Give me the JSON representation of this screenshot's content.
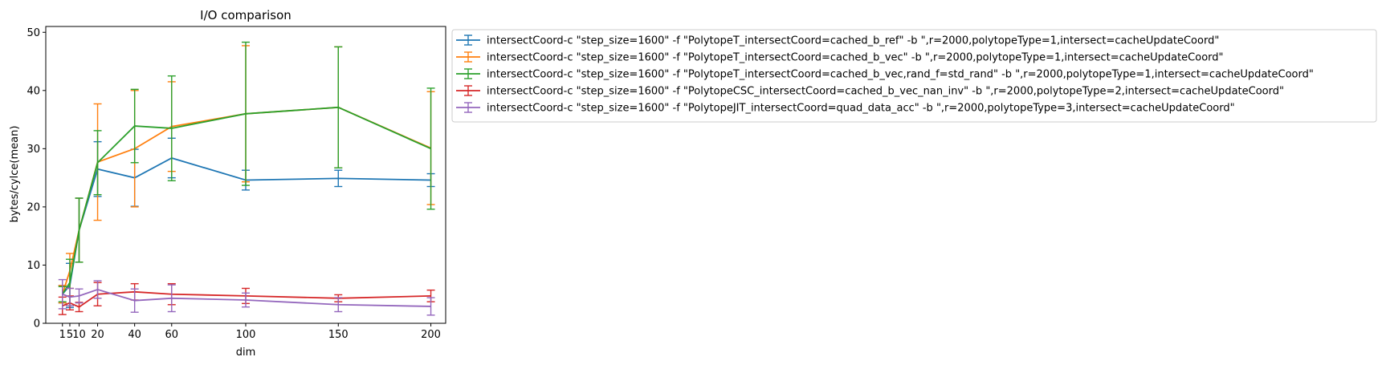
{
  "chart_data": {
    "type": "line",
    "title": "I/O comparison",
    "xlabel": "dim",
    "ylabel": "bytes/cylce(mean)",
    "xlim": [
      -8,
      208
    ],
    "ylim": [
      0,
      51
    ],
    "xticks": [
      1,
      5,
      10,
      20,
      40,
      60,
      100,
      150,
      200
    ],
    "yticks": [
      0,
      10,
      20,
      30,
      40,
      50
    ],
    "grid": false,
    "legend_position": "outside-top-right",
    "x": [
      1,
      5,
      10,
      20,
      40,
      60,
      100,
      150,
      200
    ],
    "series": [
      {
        "name": "intersectCoord-c \"step_size=1600\" -f \"PolytopeT_intersectCoord=cached_b_ref\" -b \",r=2000,polytopeType=1,intersect=cacheUpdateCoord\"",
        "color": "#1f77b4",
        "values": [
          5.0,
          6.5,
          16.0,
          26.5,
          25.0,
          28.4,
          24.6,
          24.9,
          24.6
        ],
        "err": [
          1.5,
          3.8,
          5.5,
          4.7,
          4.9,
          3.4,
          1.7,
          1.4,
          1.1
        ]
      },
      {
        "name": "intersectCoord-c \"step_size=1600\" -f \"PolytopeT_intersectCoord=cached_b_vec\" -b \",r=2000,polytopeType=1,intersect=cacheUpdateCoord\"",
        "color": "#ff7f0e",
        "values": [
          5.0,
          9.0,
          16.0,
          27.7,
          30.0,
          33.8,
          36.0,
          37.1,
          30.1
        ],
        "err": [
          1.5,
          3.0,
          5.5,
          10.0,
          10.0,
          7.7,
          11.7,
          10.4,
          9.7
        ]
      },
      {
        "name": "intersectCoord-c \"step_size=1600\" -f \"PolytopeT_intersectCoord=cached_b_vec,rand_f=std_rand\" -b \",r=2000,polytopeType=1,intersect=cacheUpdateCoord\"",
        "color": "#2ca02c",
        "values": [
          5.0,
          7.0,
          16.0,
          27.6,
          33.9,
          33.5,
          36.0,
          37.1,
          30.0
        ],
        "err": [
          1.3,
          4.0,
          5.5,
          5.5,
          6.3,
          9.0,
          12.3,
          10.4,
          10.4
        ]
      },
      {
        "name": "intersectCoord-c \"step_size=1600\" -f \"PolytopeCSC_intersectCoord=cached_b_vec_nan_inv\" -b \",r=2000,polytopeType=2,intersect=cacheUpdateCoord\"",
        "color": "#d62728",
        "values": [
          3.0,
          3.5,
          2.8,
          5.0,
          5.4,
          5.0,
          4.7,
          4.3,
          4.7
        ],
        "err": [
          1.5,
          1.2,
          0.8,
          2.0,
          1.4,
          1.8,
          1.3,
          0.6,
          1.0
        ]
      },
      {
        "name": "intersectCoord-c \"step_size=1600\" -f \"PolytopeJIT_intersectCoord=quad_data_acc\" -b \",r=2000,polytopeType=3,intersect=cacheUpdateCoord\"",
        "color": "#9467bd",
        "values": [
          5.0,
          4.5,
          4.7,
          5.8,
          3.9,
          4.3,
          4.0,
          3.2,
          2.9
        ],
        "err": [
          2.5,
          1.5,
          1.2,
          1.5,
          2.0,
          2.3,
          1.2,
          1.2,
          1.5
        ]
      }
    ]
  }
}
